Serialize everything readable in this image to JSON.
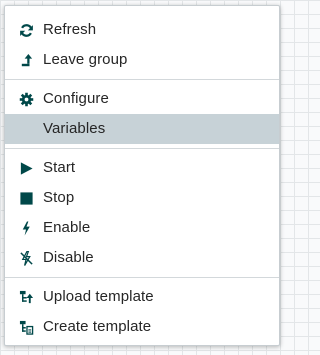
{
  "menu": {
    "items": [
      {
        "label": "Refresh",
        "icon": "refresh-icon"
      },
      {
        "label": "Leave group",
        "icon": "leave-group-icon"
      },
      {
        "label": "Configure",
        "icon": "gear-icon"
      },
      {
        "label": "Variables",
        "icon": "",
        "selected": true
      },
      {
        "label": "Start",
        "icon": "play-icon"
      },
      {
        "label": "Stop",
        "icon": "stop-icon"
      },
      {
        "label": "Enable",
        "icon": "bolt-icon"
      },
      {
        "label": "Disable",
        "icon": "bolt-off-icon"
      },
      {
        "label": "Upload template",
        "icon": "upload-template-icon"
      },
      {
        "label": "Create template",
        "icon": "create-template-icon"
      }
    ]
  },
  "colors": {
    "icon": "#004849",
    "text": "#262626",
    "selected_background": "#c7d2d7",
    "divider": "#d3d8db"
  }
}
